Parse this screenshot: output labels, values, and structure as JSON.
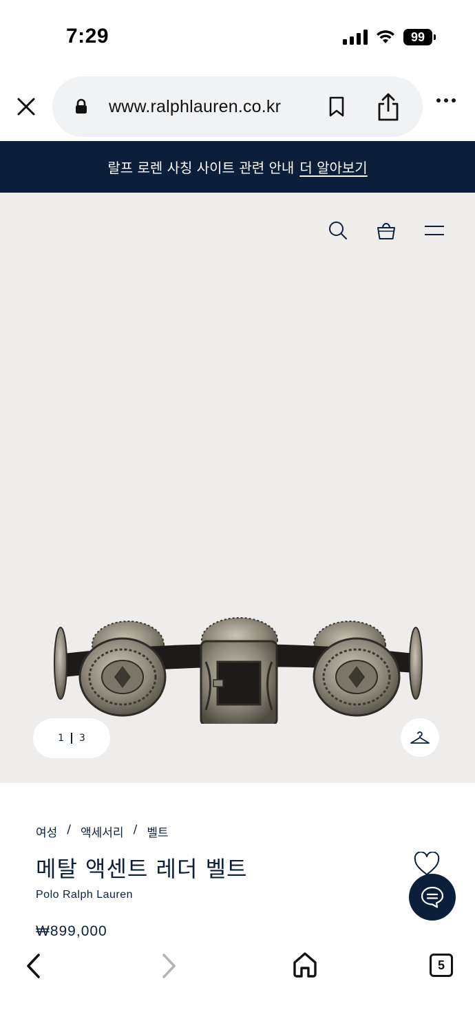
{
  "status": {
    "time": "7:29",
    "battery": "99"
  },
  "browser": {
    "url": "www.ralphlauren.co.kr",
    "tab_count": "5"
  },
  "notice": {
    "text": "랄프 로렌 사칭 사이트 관련 안내",
    "link": "더 알아보기"
  },
  "gallery": {
    "current_page": "1",
    "total_pages": "3"
  },
  "breadcrumb": [
    {
      "label": "여성"
    },
    {
      "label": "액세서리"
    },
    {
      "label": "벨트"
    }
  ],
  "breadcrumb_separator": "/",
  "product": {
    "title": "메탈 액센트 레더 벨트",
    "brand": "Polo Ralph Lauren",
    "price": "₩899,000"
  },
  "icons": {
    "close": "close-icon",
    "lock": "lock-icon",
    "bookmark": "bookmark-icon",
    "share": "share-icon",
    "more": "more-icon",
    "search": "search-icon",
    "bag": "shopping-bag-icon",
    "menu": "hamburger-menu-icon",
    "hanger": "hanger-icon",
    "heart": "heart-icon",
    "chat": "chat-icon",
    "back": "chevron-left-icon",
    "forward": "chevron-right-icon",
    "home": "home-icon"
  },
  "colors": {
    "navy": "#0b1f3a",
    "hero_background": "#efedeb",
    "url_pill": "#f1f2f4"
  }
}
